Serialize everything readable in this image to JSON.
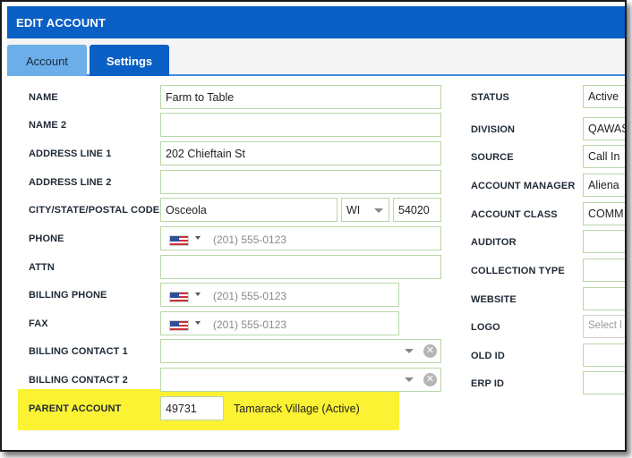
{
  "dialog": {
    "title": "EDIT ACCOUNT"
  },
  "tabs": {
    "account": "Account",
    "settings": "Settings"
  },
  "left": {
    "name_label": "NAME",
    "name_value": "Farm to Table",
    "name2_label": "NAME 2",
    "name2_value": "",
    "address1_label": "ADDRESS LINE 1",
    "address1_value": "202 Chieftain St",
    "address2_label": "ADDRESS LINE 2",
    "address2_value": "",
    "csp_label": "CITY/STATE/POSTAL CODE",
    "city_value": "Osceola",
    "state_value": "WI",
    "postal_value": "54020",
    "phone_label": "PHONE",
    "phone_placeholder": "(201) 555-0123",
    "attn_label": "ATTN",
    "attn_value": "",
    "billing_phone_label": "BILLING PHONE",
    "billing_phone_placeholder": "(201) 555-0123",
    "fax_label": "FAX",
    "fax_placeholder": "(201) 555-0123",
    "billing_contact1_label": "BILLING CONTACT 1",
    "billing_contact2_label": "BILLING CONTACT 2",
    "parent_account_label": "PARENT ACCOUNT",
    "parent_account_id": "49731",
    "parent_account_name": "Tamarack Village (Active)",
    "clear_glyph": "✕"
  },
  "right": {
    "status_label": "STATUS",
    "status_value": "Active",
    "division_label": "DIVISION",
    "division_value": "QAWAS",
    "source_label": "SOURCE",
    "source_value": "Call In",
    "account_manager_label": "ACCOUNT MANAGER",
    "account_manager_value": "Aliena",
    "account_class_label": "ACCOUNT CLASS",
    "account_class_value": "COMM",
    "auditor_label": "AUDITOR",
    "collection_type_label": "COLLECTION TYPE",
    "website_label": "WEBSITE",
    "logo_label": "LOGO",
    "logo_placeholder": "Select l",
    "old_id_label": "OLD ID",
    "erp_id_label": "ERP ID"
  },
  "colors": {
    "brand_blue": "#0a5fc4",
    "active_tab": "#6caee9",
    "field_border": "#b8d7a7",
    "highlight": "#fbf234"
  }
}
